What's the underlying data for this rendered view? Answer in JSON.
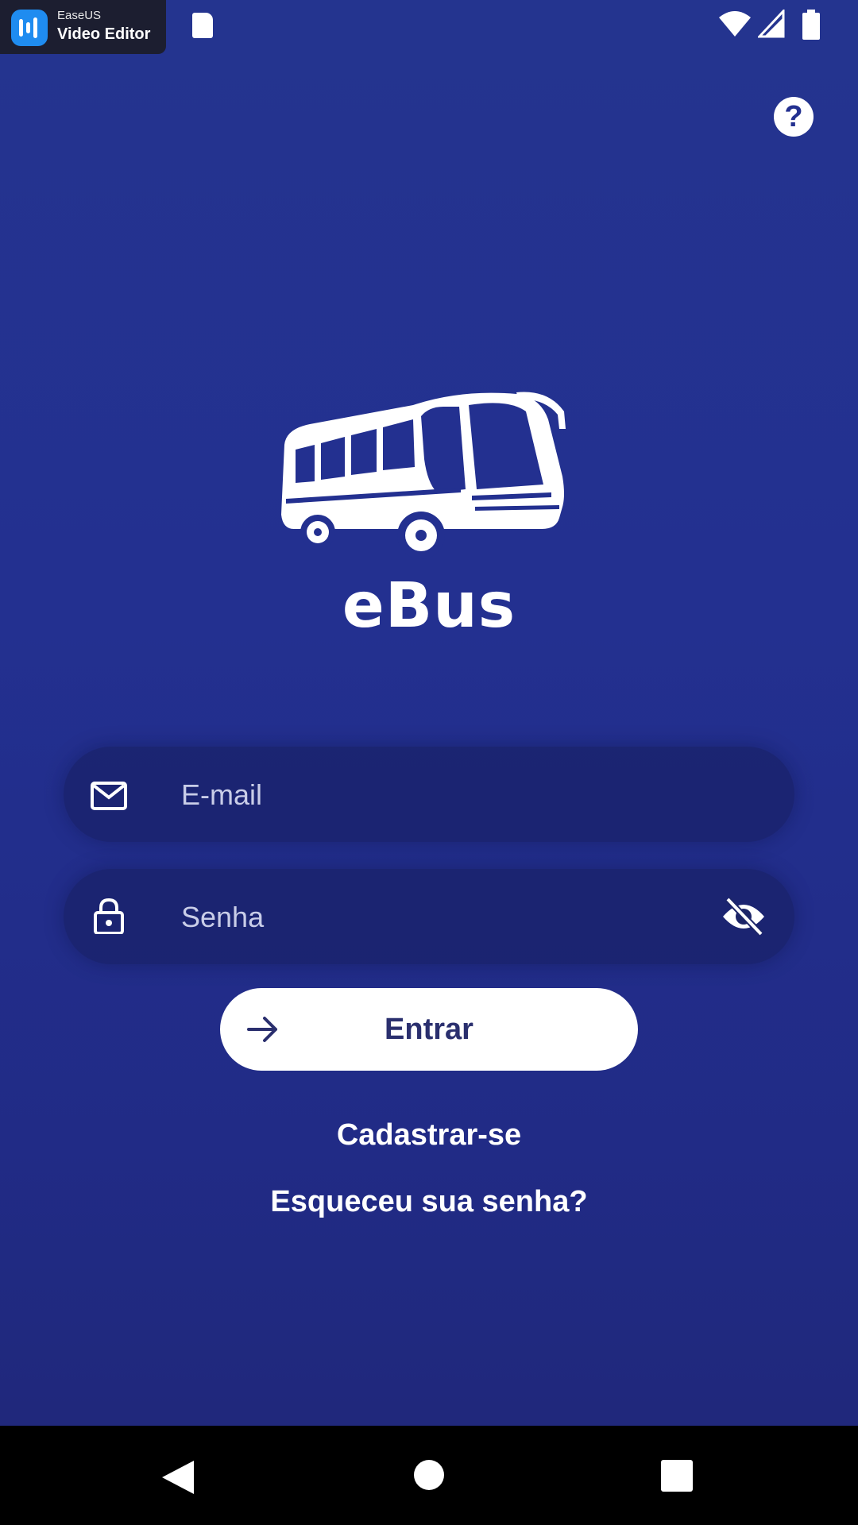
{
  "status_bar": {
    "recorder_brand": "EaseUS",
    "recorder_name": "Video Editor",
    "icons": [
      "sd-card-icon",
      "wifi-icon",
      "cell-signal-icon",
      "battery-icon"
    ]
  },
  "help": {
    "icon": "help-icon",
    "label": "?"
  },
  "logo": {
    "icon": "bus-icon",
    "app_name": "eBus"
  },
  "form": {
    "email": {
      "placeholder": "E-mail",
      "value": "",
      "icon": "mail-icon"
    },
    "password": {
      "placeholder": "Senha",
      "value": "",
      "icon": "lock-icon",
      "toggle_icon": "eye-off-icon"
    },
    "submit": {
      "label": "Entrar",
      "icon": "arrow-right-icon"
    }
  },
  "links": {
    "register": "Cadastrar-se",
    "forgot_password": "Esqueceu sua senha?"
  },
  "navigation": {
    "icons": [
      "back-icon",
      "home-icon",
      "recents-icon"
    ]
  },
  "colors": {
    "background": "#233090",
    "button_background": "#ffffff",
    "button_text": "#2a2f6e",
    "text": "#ffffff"
  }
}
